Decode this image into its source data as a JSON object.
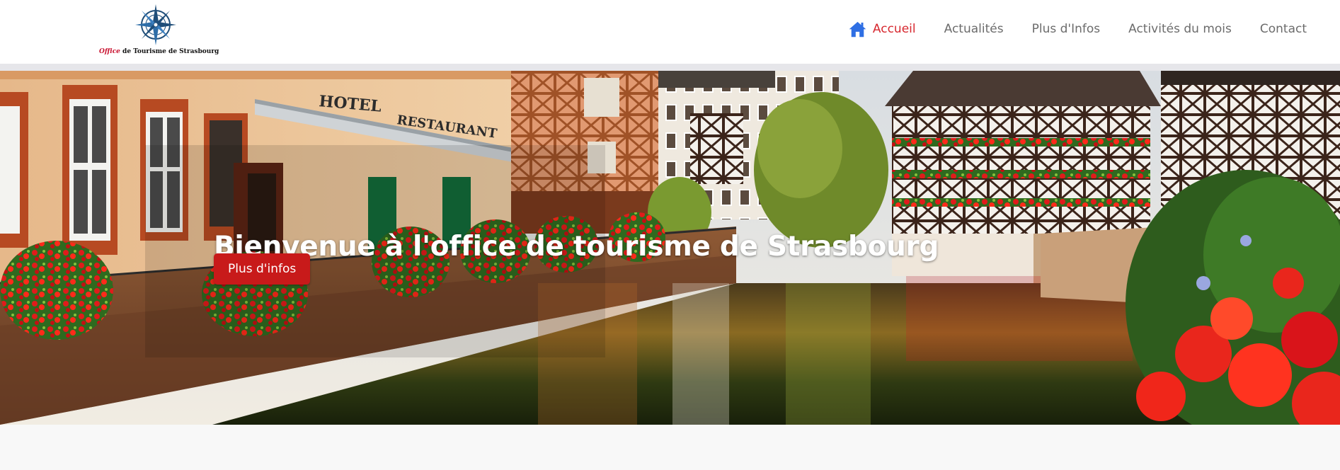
{
  "logo": {
    "accent": "Office",
    "rest": " de Tourisme de Strasbourg",
    "icon": "compass-rose-icon"
  },
  "nav": {
    "items": [
      {
        "label": "Accueil",
        "icon": "home-icon",
        "active": true
      },
      {
        "label": "Actualités"
      },
      {
        "label": "Plus d'Infos"
      },
      {
        "label": "Activités du mois"
      },
      {
        "label": "Contact"
      }
    ],
    "active_color": "#d7282f",
    "icon_color": "#2f6fe4"
  },
  "hero": {
    "title": "Bienvenue à l'office de tourisme de Strasbourg",
    "button_label": "Plus d'infos",
    "photo_signs": {
      "hotel": "HOTEL",
      "restaurant": "RESTAURANT"
    }
  },
  "colors": {
    "brand_red": "#c81a1a",
    "nav_text": "#6c6c6c"
  }
}
